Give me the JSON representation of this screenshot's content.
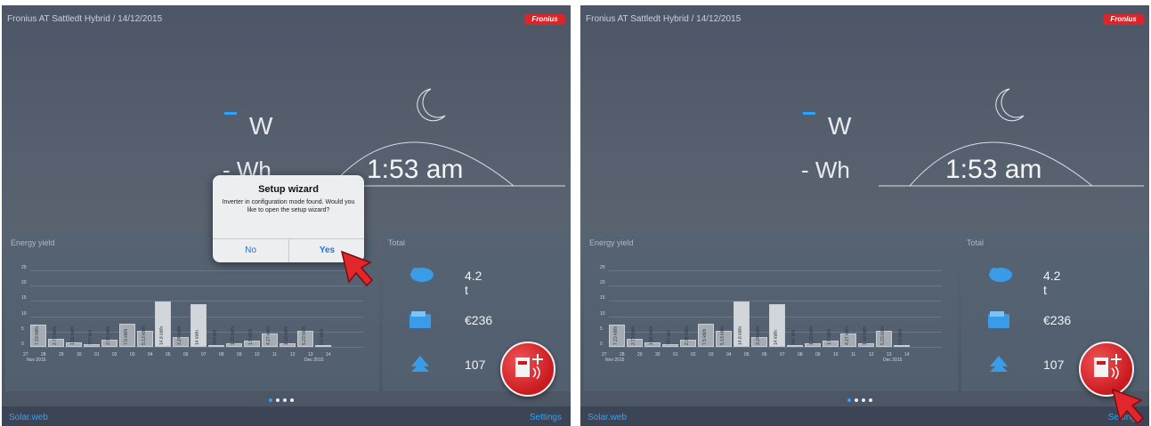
{
  "screens": [
    {
      "header": {
        "title": "Fronius AT Sattledt Hybrid / 14/12/2015",
        "logo": "Fronius"
      },
      "live": {
        "power_value": "-",
        "power_unit": "W",
        "energy_text": "- Wh",
        "clock": "1:53 am"
      },
      "energy_yield": {
        "title": "Energy yield",
        "y_ticks": [
          "25",
          "20",
          "15",
          "10",
          "5",
          "0"
        ],
        "bars": [
          {
            "label": "7.23 kWh",
            "value": 7.23
          },
          {
            "label": "2.73 kWh",
            "value": 2.73
          },
          {
            "label": "1.56 kWh",
            "value": 1.56
          },
          {
            "label": "797 Wh",
            "value": 0.8
          },
          {
            "label": "2.36 kWh",
            "value": 2.36
          },
          {
            "label": "7.5 kWh",
            "value": 7.5
          },
          {
            "label": "5.13 kWh",
            "value": 5.13
          },
          {
            "label": "14.8 kWh",
            "value": 14.8
          },
          {
            "label": "3.24 kWh",
            "value": 3.24
          },
          {
            "label": "14 kWh",
            "value": 14.0
          },
          {
            "label": "354 Wh",
            "value": 0.35
          },
          {
            "label": "1.29 kWh",
            "value": 1.29
          },
          {
            "label": "1.9 kWh",
            "value": 1.9
          },
          {
            "label": "4.27 kWh",
            "value": 4.27
          },
          {
            "label": "1.16 kWh",
            "value": 1.16
          },
          {
            "label": "5.23 kWh",
            "value": 5.23
          },
          {
            "label": "0.0 kWh",
            "value": 0.0
          }
        ],
        "x_ticks": [
          "27",
          "28",
          "29",
          "30",
          "01",
          "02",
          "03",
          "04",
          "05",
          "06",
          "07",
          "08",
          "09",
          "10",
          "11",
          "12",
          "13",
          "14"
        ],
        "x_sub_left": "Nov 2015",
        "x_sub_right": "Dec 2015"
      },
      "total": {
        "title": "Total",
        "rows": [
          {
            "icon": "co2-cloud-icon",
            "value": "4.2 t"
          },
          {
            "icon": "wallet-icon",
            "value": "€236"
          },
          {
            "icon": "tree-icon",
            "value": "107"
          }
        ]
      },
      "footer": {
        "left_link": "Solar.web",
        "right_link": "Settings"
      },
      "dialog": {
        "title": "Setup wizard",
        "message": "Inverter in configuration mode found. Would you like to open the setup wizard?",
        "no_label": "No",
        "yes_label": "Yes"
      }
    },
    {
      "header": {
        "title": "Fronius AT Sattledt Hybrid / 14/12/2015",
        "logo": "Fronius"
      },
      "live": {
        "power_value": "-",
        "power_unit": "W",
        "energy_text": "- Wh",
        "clock": "1:53 am"
      },
      "energy_yield": {
        "title": "Energy yield",
        "y_ticks": [
          "25",
          "20",
          "15",
          "10",
          "5",
          "0"
        ],
        "bars": [
          {
            "label": "7.23 kWh",
            "value": 7.23
          },
          {
            "label": "2.73 kWh",
            "value": 2.73
          },
          {
            "label": "1.56 kWh",
            "value": 1.56
          },
          {
            "label": "797 Wh",
            "value": 0.8
          },
          {
            "label": "2.36 kWh",
            "value": 2.36
          },
          {
            "label": "7.5 kWh",
            "value": 7.5
          },
          {
            "label": "5.13 kWh",
            "value": 5.13
          },
          {
            "label": "14.8 kWh",
            "value": 14.8
          },
          {
            "label": "3.24 kWh",
            "value": 3.24
          },
          {
            "label": "14 kWh",
            "value": 14.0
          },
          {
            "label": "354 Wh",
            "value": 0.35
          },
          {
            "label": "1.29 kWh",
            "value": 1.29
          },
          {
            "label": "1.9 kWh",
            "value": 1.9
          },
          {
            "label": "4.27 kWh",
            "value": 4.27
          },
          {
            "label": "1.16 kWh",
            "value": 1.16
          },
          {
            "label": "5.23 kWh",
            "value": 5.23
          },
          {
            "label": "0.0 kWh",
            "value": 0.0
          }
        ],
        "x_ticks": [
          "27",
          "28",
          "29",
          "30",
          "01",
          "02",
          "03",
          "04",
          "05",
          "06",
          "07",
          "08",
          "09",
          "10",
          "11",
          "12",
          "13",
          "14"
        ],
        "x_sub_left": "Nov 2015",
        "x_sub_right": "Dec 2015"
      },
      "total": {
        "title": "Total",
        "rows": [
          {
            "icon": "co2-cloud-icon",
            "value": "4.2 t"
          },
          {
            "icon": "wallet-icon",
            "value": "€236"
          },
          {
            "icon": "tree-icon",
            "value": "107"
          }
        ]
      },
      "footer": {
        "left_link": "Solar.web",
        "right_link": "Settings"
      }
    }
  ],
  "colors": {
    "accent": "#2ba3ff",
    "brand_red": "#d9262b"
  }
}
